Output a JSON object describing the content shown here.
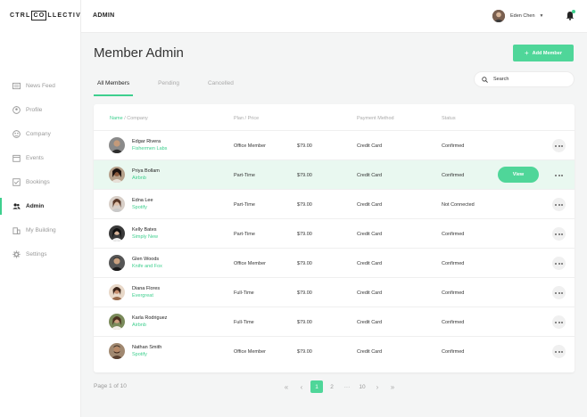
{
  "brand": {
    "logo_left": "CTRL",
    "logo_box": "CO",
    "logo_right": "LLECTIVE"
  },
  "topbar": {
    "title": "ADMIN",
    "user_name": "Eden Chen"
  },
  "sidebar": {
    "items": [
      {
        "label": "News Feed",
        "icon": "news-icon"
      },
      {
        "label": "Profile",
        "icon": "profile-icon"
      },
      {
        "label": "Company",
        "icon": "company-icon"
      },
      {
        "label": "Events",
        "icon": "calendar-icon"
      },
      {
        "label": "Bookings",
        "icon": "bookings-icon"
      },
      {
        "label": "Admin",
        "icon": "users-icon",
        "active": true
      },
      {
        "label": "My Building",
        "icon": "building-icon"
      },
      {
        "label": "Settings",
        "icon": "gear-icon"
      }
    ]
  },
  "page": {
    "title": "Member Admin",
    "add_button": "Add Member"
  },
  "tabs": [
    "All Members",
    "Pending",
    "Cancelled"
  ],
  "search": {
    "placeholder": "Search"
  },
  "table": {
    "headers": {
      "name": "Name",
      "sep": "/",
      "company": "Company",
      "plan": "Plan / Price",
      "payment": "Payment Method",
      "status": "Status"
    },
    "view_label": "View",
    "rows": [
      {
        "name": "Edgar Rivera",
        "company": "Fishermen Labs",
        "plan": "Office Member",
        "price": "$79.00",
        "payment": "Credit Card",
        "status": "Confirmed"
      },
      {
        "name": "Priya Bollam",
        "company": "Airbnb",
        "plan": "Part-Time",
        "price": "$79.00",
        "payment": "Credit Card",
        "status": "Confirmed"
      },
      {
        "name": "Edna Lee",
        "company": "Spotify",
        "plan": "Part-Time",
        "price": "$79.00",
        "payment": "Credit Card",
        "status": "Not Connected"
      },
      {
        "name": "Kelly Bates",
        "company": "Simply New",
        "plan": "Part-Time",
        "price": "$79.00",
        "payment": "Credit Card",
        "status": "Confirmed"
      },
      {
        "name": "Glen Woods",
        "company": "Knife and Fox",
        "plan": "Office Member",
        "price": "$79.00",
        "payment": "Credit Card",
        "status": "Confirmed"
      },
      {
        "name": "Diana Flores",
        "company": "Evergreat",
        "plan": "Full-Time",
        "price": "$79.00",
        "payment": "Credit Card",
        "status": "Confirmed"
      },
      {
        "name": "Karla Rodriguez",
        "company": "Airbnb",
        "plan": "Full-Time",
        "price": "$79.00",
        "payment": "Credit Card",
        "status": "Confirmed"
      },
      {
        "name": "Nathan Smith",
        "company": "Spotify",
        "plan": "Office Member",
        "price": "$79.00",
        "payment": "Credit Card",
        "status": "Confirmed"
      }
    ]
  },
  "pagination": {
    "info": "Page 1 of 10",
    "current": "1",
    "next": "2",
    "ellipsis": "···",
    "last": "10"
  },
  "colors": {
    "accent": "#3ecf8e",
    "button": "#4fd699",
    "highlight_row": "#e9f8f0"
  }
}
